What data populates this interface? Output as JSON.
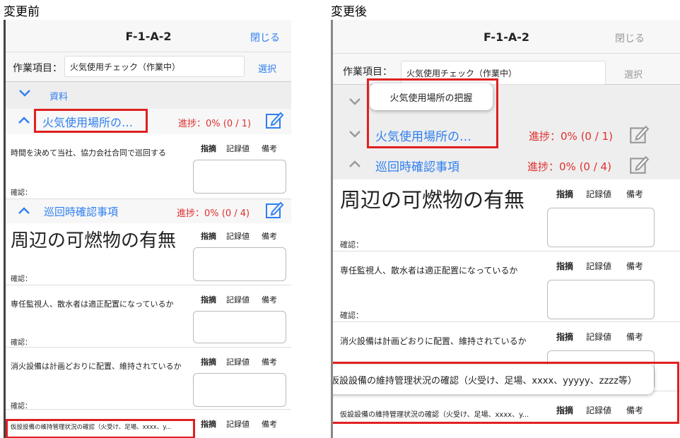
{
  "captions": {
    "before": "変更前",
    "after": "変更後"
  },
  "header": {
    "title": "F-1-A-2",
    "close_label": "閉じる"
  },
  "work": {
    "label": "作業項目：",
    "value": "火気使用チェック（作業中）",
    "select_label": "選択"
  },
  "sections": {
    "materials": "資料",
    "fire_title_truncated": "火気使用場所の…",
    "fire_progress": "進捗：0% (0 / 1)",
    "patrol_title": "巡回時確認事項",
    "patrol_progress": "進捗：0% (0 / 4)"
  },
  "columns": {
    "point": "指摘",
    "record": "記録値",
    "remark": "備考"
  },
  "confirm_label": "確認：",
  "items": {
    "time_patrol": "時間を決めて当社、協力会社合同で巡回する",
    "combustibles": "周辺の可燃物の有無",
    "watchman": "専任監視人、散水者は適正配置になっているか",
    "extinguisher": "消火設備は計画どおりに配置、維持されているか",
    "temp_facility_truncated": "仮設設備の維持管理状況の確認（火受け、足場、xxxx、y...",
    "temp_facility_truncated_after": "仮設設備の維持管理状況の確認（火受け、足場、xxxx、y..."
  },
  "tooltips": {
    "fire_full": "火気使用場所の把握",
    "temp_facility_full": "仮設設備の維持管理状況の確認（火受け、足場、xxxx、yyyyy、zzzz等）"
  },
  "colors": {
    "accent": "#2f7ff0",
    "progress": "#e03030",
    "highlight": "#e02020"
  },
  "icons": [
    "chevron-down-icon",
    "chevron-up-icon",
    "edit-note-icon"
  ]
}
